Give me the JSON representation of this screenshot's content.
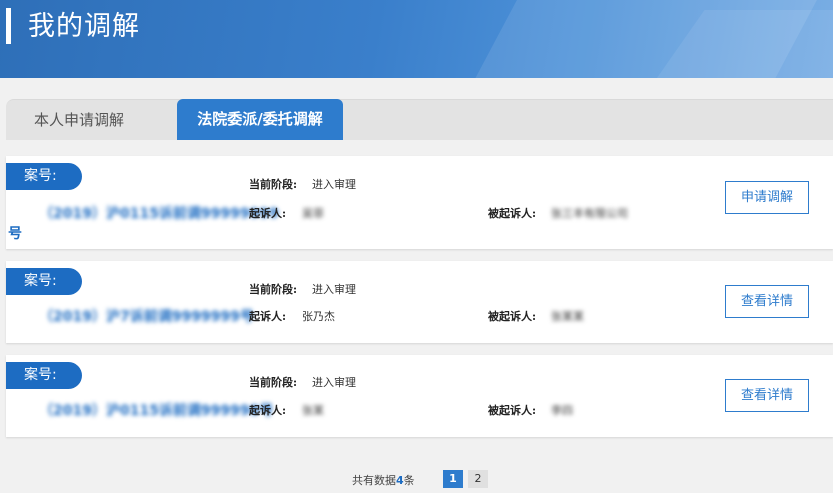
{
  "header": {
    "title": "我的调解"
  },
  "tabs": [
    {
      "label": "本人申请调解"
    },
    {
      "label": "法院委派/委托调解"
    }
  ],
  "labels": {
    "case_badge": "案号:",
    "stage": "当前阶段:",
    "plaintiff": "起诉人:",
    "defendant": "被起诉人:"
  },
  "cases": [
    {
      "case_no": "（2019）沪0115诉前调99999999",
      "case_no_tail": "号",
      "stage": "进入审理",
      "plaintiff": "吴菲",
      "defendant": "张三丰有限公司",
      "button": "申请调解"
    },
    {
      "case_no": "（2019）沪7诉前调9999999号",
      "stage": "进入审理",
      "plaintiff": "张乃杰",
      "defendant": "张某某",
      "button": "查看详情"
    },
    {
      "case_no": "（2019）沪0115诉前调999998号",
      "stage": "进入审理",
      "plaintiff": "张某",
      "defendant": "李四",
      "button": "查看详情"
    }
  ],
  "pagination": {
    "total_prefix": "共有数据",
    "total_count": "4",
    "total_suffix": "条",
    "pages": [
      "1",
      "2"
    ],
    "current": "1"
  }
}
